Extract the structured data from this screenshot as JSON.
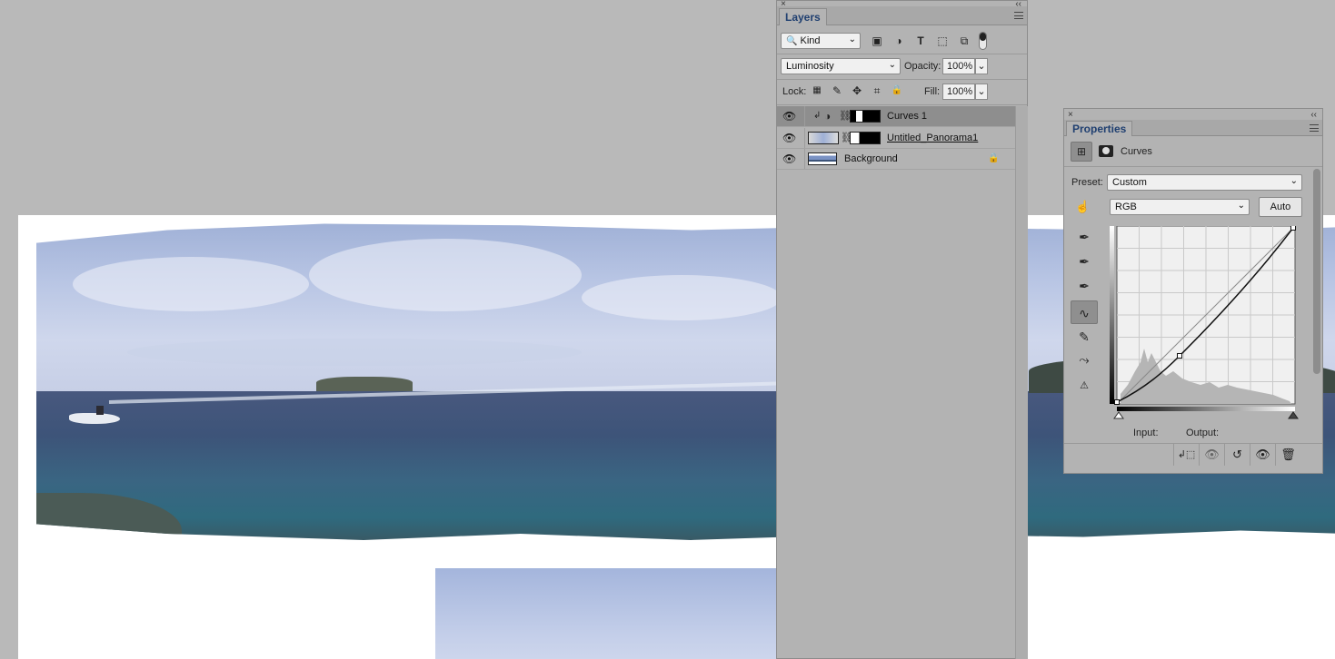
{
  "layers_panel": {
    "tab_label": "Layers",
    "close_glyph": "×",
    "collapse_glyph": "‹‹",
    "filter_kind": "Kind",
    "blend_mode": "Luminosity",
    "opacity_label": "Opacity:",
    "opacity_value": "100%",
    "lock_label": "Lock:",
    "fill_label": "Fill:",
    "fill_value": "100%",
    "layers": [
      {
        "name": "Curves 1",
        "selected": true
      },
      {
        "name": "Untitled_Panorama1",
        "selected": false
      },
      {
        "name": "Background",
        "selected": false
      }
    ]
  },
  "properties_panel": {
    "tab_label": "Properties",
    "close_glyph": "×",
    "collapse_glyph": "‹‹",
    "title": "Curves",
    "preset_label": "Preset:",
    "preset_value": "Custom",
    "channel_value": "RGB",
    "auto_label": "Auto",
    "input_label": "Input:",
    "output_label": "Output:"
  },
  "icons": {
    "eye": "👁",
    "lock": "🔒",
    "chevron": "⌄"
  },
  "colors": {
    "panel_bg": "#b3b3b3",
    "workspace_bg": "#b9b9b9",
    "tab_text": "#1f3f70",
    "selected_row": "#8e8e8e"
  }
}
